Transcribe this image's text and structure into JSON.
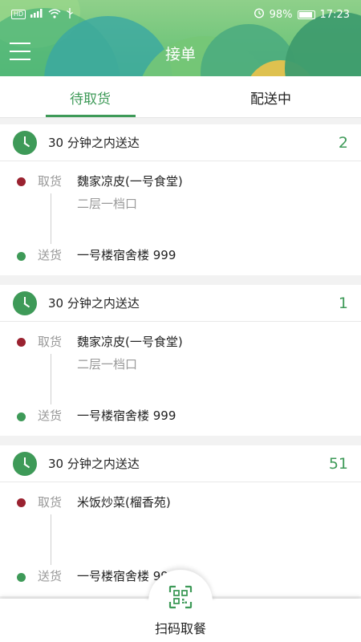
{
  "statusbar": {
    "left": [
      "HD",
      "4G",
      "wifi",
      "usb"
    ],
    "battery": "98%",
    "time": "17:23"
  },
  "header": {
    "title": "接单"
  },
  "tabs": [
    {
      "label": "待取货",
      "active": true
    },
    {
      "label": "配送中",
      "active": false
    }
  ],
  "orders": [
    {
      "time_label": "30 分钟之内送达",
      "count": "2",
      "pickup_label": "取货",
      "pickup_shop": "魏家凉皮(一号食堂)",
      "pickup_sub": "二层一档口",
      "delivery_label": "送货",
      "delivery_address": "一号楼宿舍楼 999"
    },
    {
      "time_label": "30 分钟之内送达",
      "count": "1",
      "pickup_label": "取货",
      "pickup_shop": "魏家凉皮(一号食堂)",
      "pickup_sub": "二层一档口",
      "delivery_label": "送货",
      "delivery_address": "一号楼宿舍楼 999"
    },
    {
      "time_label": "30 分钟之内送达",
      "count": "51",
      "pickup_label": "取货",
      "pickup_shop": "米饭炒菜(榴香苑)",
      "pickup_sub": "",
      "delivery_label": "送货",
      "delivery_address": "一号楼宿舍楼 999"
    }
  ],
  "bottom": {
    "scan_label": "扫码取餐",
    "icon": "qr-scan-icon"
  },
  "colors": {
    "accent": "#3e9a58",
    "pickup_dot": "#9a2230"
  }
}
